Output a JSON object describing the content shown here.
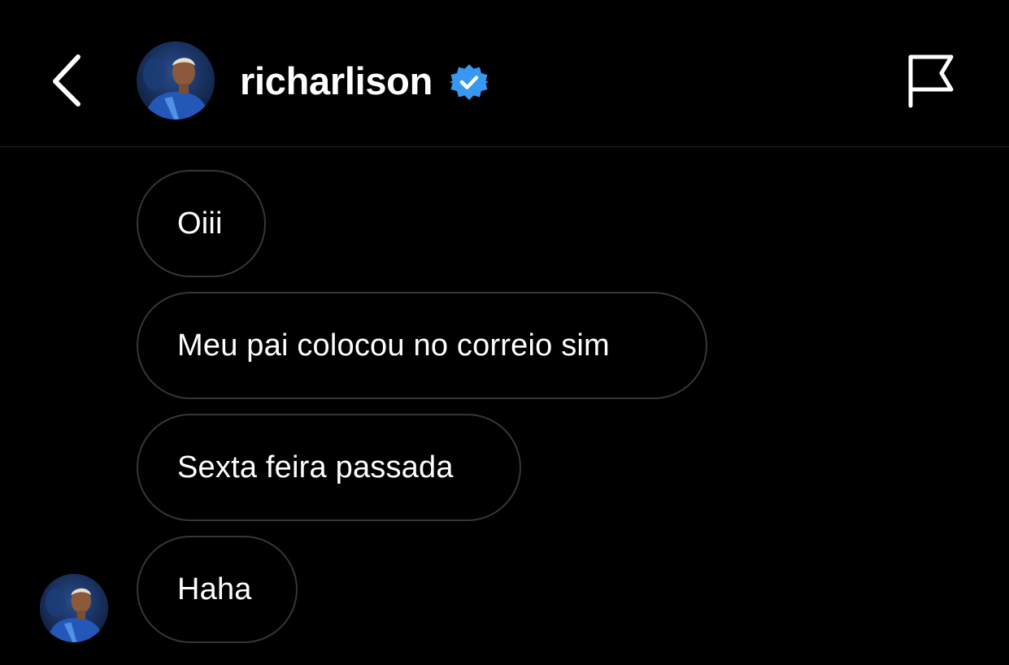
{
  "header": {
    "username": "richarlison",
    "verified": true,
    "back_icon": "chevron-left-icon",
    "report_icon": "flag-icon",
    "verified_icon": "verified-badge-icon",
    "colors": {
      "background": "#000000",
      "verified_badge": "#3897f0",
      "bubble_border": "#363636",
      "text": "#ffffff"
    }
  },
  "messages": [
    {
      "text": "Oiii"
    },
    {
      "text": "Meu pai colocou no correio sim"
    },
    {
      "text": "Sexta feira passada"
    },
    {
      "text": "Haha"
    }
  ]
}
